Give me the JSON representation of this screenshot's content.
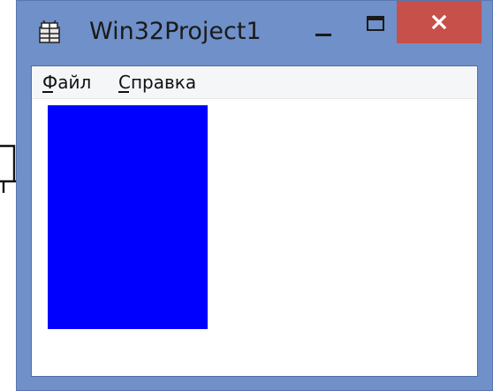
{
  "window": {
    "title": "Win32Project1",
    "frame_color": "#6f90c8",
    "close_color": "#c7504a"
  },
  "menu": {
    "items": [
      {
        "label": "Файл"
      },
      {
        "label": "Справка"
      }
    ]
  },
  "client": {
    "rect_color": "#0000ff"
  },
  "icons": {
    "app": "app-icon",
    "minimize": "minimize-icon",
    "maximize": "maximize-icon",
    "close": "close-icon"
  }
}
